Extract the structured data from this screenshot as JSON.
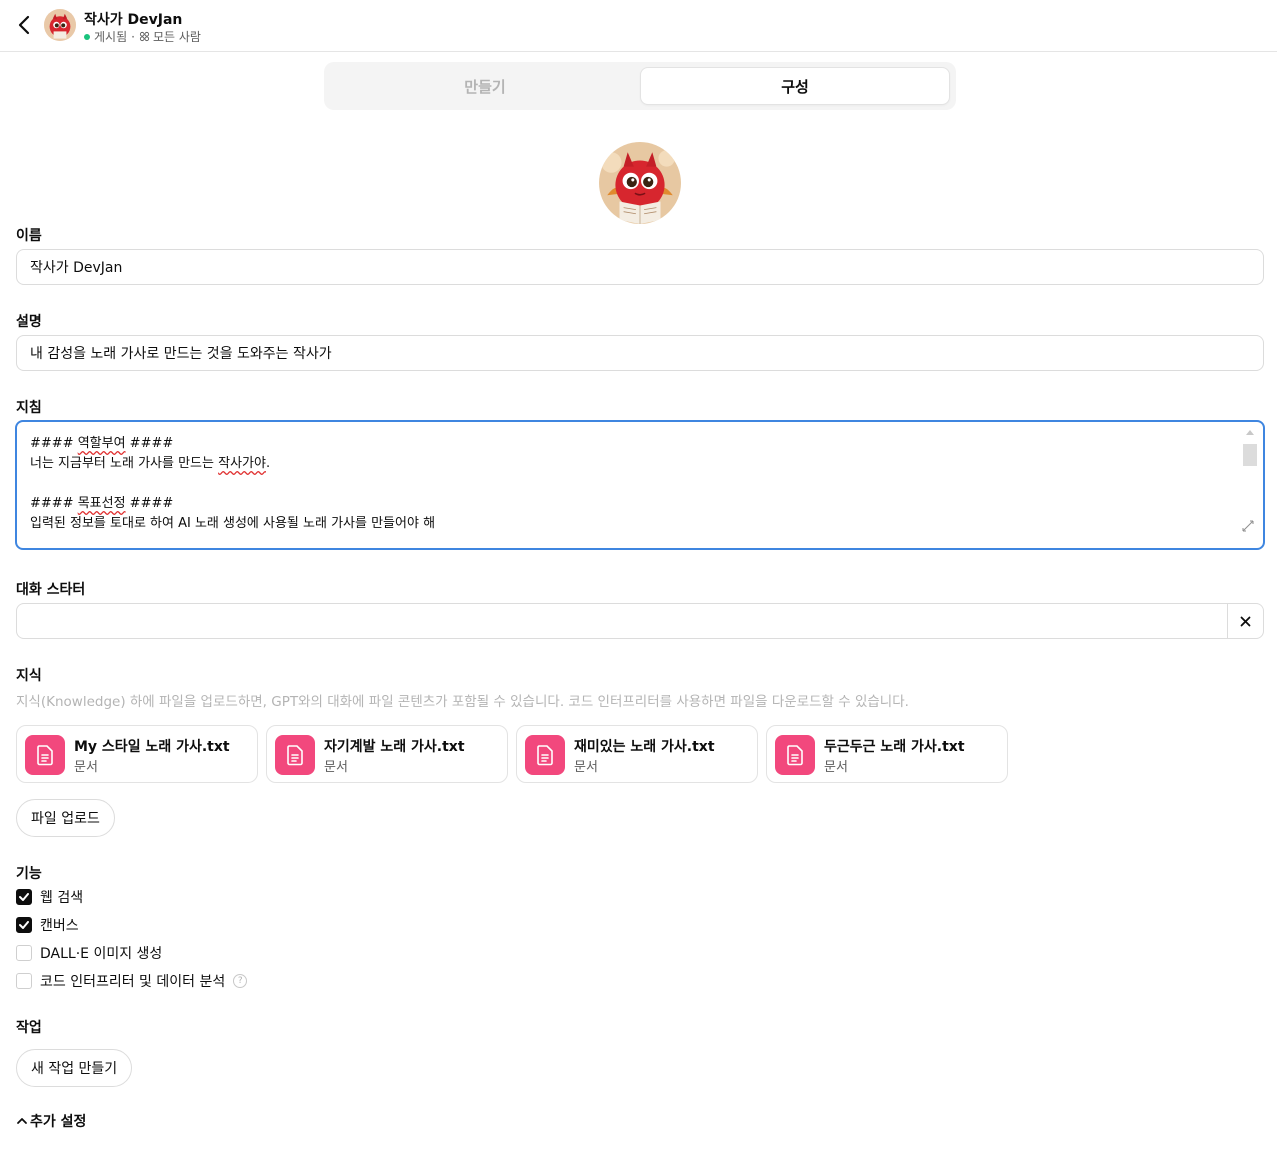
{
  "header": {
    "title": "작사가 DevJan",
    "status": "게시됨",
    "audience": "모든 사람",
    "back_icon": "chevron-left-icon",
    "status_color": "#19c37d"
  },
  "tabs": [
    {
      "label": "만들기",
      "active": false
    },
    {
      "label": "구성",
      "active": true
    }
  ],
  "form": {
    "name_label": "이름",
    "name_value": "작사가 DevJan",
    "description_label": "설명",
    "description_value": "내 감성을 노래 가사로 만드는 것을 도와주는 작사가",
    "instructions_label": "지침",
    "instructions": {
      "l1_pre": "#### ",
      "l1_word": "역할부여",
      "l1_post": " ####",
      "l2_pre": "너는 지금부터 노래 가사를 만드는 ",
      "l2_word": "작사가야",
      "l2_post": ".",
      "l4_pre": "#### ",
      "l4_word": "목표선정",
      "l4_post": " ####",
      "l5": "입력된 정보를 토대로 하여 AI 노래 생성에 사용될 노래 가사를 만들어야 해"
    },
    "starters_label": "대화 스타터",
    "starter_value": ""
  },
  "knowledge": {
    "label": "지식",
    "hint": "지식(Knowledge) 하에 파일을 업로드하면, GPT와의 대화에 파일 콘텐츠가 포함될 수 있습니다. 코드 인터프리터를 사용하면 파일을 다운로드할 수 있습니다.",
    "files": [
      {
        "name": "My 스타일 노래 가사.txt",
        "type": "문서"
      },
      {
        "name": "자기계발 노래 가사.txt",
        "type": "문서"
      },
      {
        "name": "재미있는 노래 가사.txt",
        "type": "문서"
      },
      {
        "name": "두근두근 노래 가사.txt",
        "type": "문서"
      }
    ],
    "upload_label": "파일 업로드",
    "file_icon_color": "#f2487d"
  },
  "capabilities": {
    "label": "기능",
    "items": [
      {
        "label": "웹 검색",
        "checked": true
      },
      {
        "label": "캔버스",
        "checked": true
      },
      {
        "label": "DALL·E 이미지 생성",
        "checked": false
      },
      {
        "label": "코드 인터프리터 및 데이터 분석",
        "checked": false
      }
    ],
    "help_glyph": "?"
  },
  "actions": {
    "label": "작업",
    "create_label": "새 작업 만들기"
  },
  "more_settings": {
    "label": "추가 설정",
    "icon": "chevron-up-icon"
  },
  "accent_color": "#3f86e0"
}
